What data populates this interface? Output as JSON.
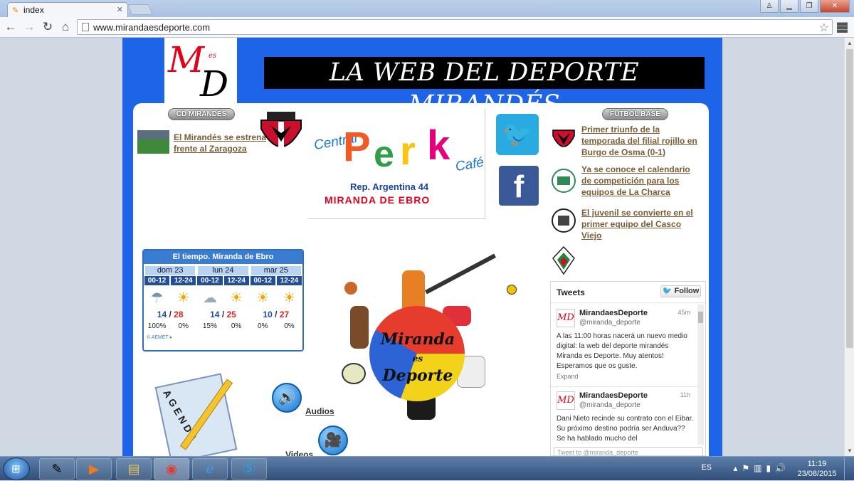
{
  "browser": {
    "tab_title": "index",
    "url": "www.mirandaesdeporte.com"
  },
  "site": {
    "logo_m": "M",
    "logo_es": "es",
    "logo_d": "D",
    "banner": "LA WEB DEL DEPORTE MIRANDÉS",
    "section_cd": "CD MIRANDÉS",
    "section_base": "FUTBOL BASE",
    "cd_news": "El Mirandés se estrena frente al Zaragoza",
    "base_news": [
      "Primer triunfo de la temporada del filial rojillo en Burgo de Osma (0-1)",
      "Ya se conoce el calendario de competición para los equipos de La Charca",
      "El juvenil se convierte en el primer equipo del Casco Viejo"
    ]
  },
  "ad": {
    "central": "Central",
    "p": "P",
    "e": "e",
    "r": "r",
    "k": "k",
    "cafe": "Café",
    "address": "Rep. Argentina 44",
    "city": "MIRANDA DE EBRO"
  },
  "weather": {
    "title": "El tiempo. Miranda de Ebro",
    "days": [
      "dom 23",
      "lun 24",
      "mar 25"
    ],
    "slots": [
      "00-12",
      "12-24",
      "00-12",
      "12-24",
      "00-12",
      "12-24"
    ],
    "icons": [
      "☂",
      "☀",
      "☁",
      "☀",
      "☀",
      "☀"
    ],
    "temps": [
      {
        "min": "14",
        "max": "28"
      },
      {
        "min": "14",
        "max": "25"
      },
      {
        "min": "10",
        "max": "27"
      }
    ],
    "slash": "/",
    "probs": [
      "100%",
      "0%",
      "15%",
      "0%",
      "0%",
      "0%"
    ],
    "source": "© AEMET ▸"
  },
  "agenda": {
    "text": "AGENDA"
  },
  "media": {
    "audios": "Audios",
    "videos": "Videos"
  },
  "mascot": {
    "line1": "Miranda",
    "line2": "es",
    "line3": "Deporte"
  },
  "tweets": {
    "header": "Tweets",
    "follow": "Follow",
    "items": [
      {
        "name": "MirandaesDeporte",
        "handle": "@miranda_deporte",
        "time": "45m",
        "body": "A las 11:00 horas nacerá un nuevo medio digital: la web del deporte mirandés Miranda es Deporte. Muy atentos! Esperamos que os guste.",
        "expand": "Expand"
      },
      {
        "name": "MirandaesDeporte",
        "handle": "@miranda_deporte",
        "time": "11h",
        "body": "Dani Nieto recinde su contrato con el Eibar. Su próximo destino podría ser Anduva?? Se ha hablado mucho del",
        "expand": ""
      }
    ],
    "compose": "Tweet to @miranda_deporte"
  },
  "taskbar": {
    "lang": "ES",
    "time": "11:19",
    "date": "23/08/2015"
  }
}
